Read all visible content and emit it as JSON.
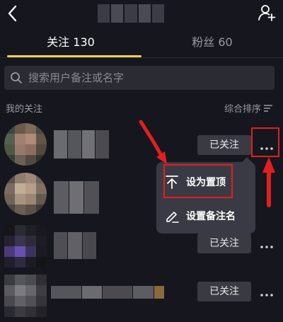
{
  "header": {
    "back_icon": "chevron-left-icon",
    "add_user_icon": "add-user-icon"
  },
  "tabs": [
    {
      "label": "关注 130",
      "active": true
    },
    {
      "label": "粉丝 60",
      "active": false
    }
  ],
  "search": {
    "placeholder": "搜索用户备注或名字",
    "value": ""
  },
  "list": {
    "section_label": "我的关注",
    "sort_label": "综合排序",
    "items": [
      {
        "button": "已关注"
      },
      {
        "button": ""
      },
      {
        "button": "已关注"
      },
      {
        "button": "已关注"
      }
    ]
  },
  "popup_menu": {
    "items": [
      {
        "label": "设为置顶",
        "icon": "pin-to-top-icon"
      },
      {
        "label": "设置备注名",
        "icon": "edit-pencil-icon"
      }
    ]
  },
  "colors": {
    "background": "#16161e",
    "tab_indicator": "#f1d24a",
    "annotation": "#e02020"
  }
}
